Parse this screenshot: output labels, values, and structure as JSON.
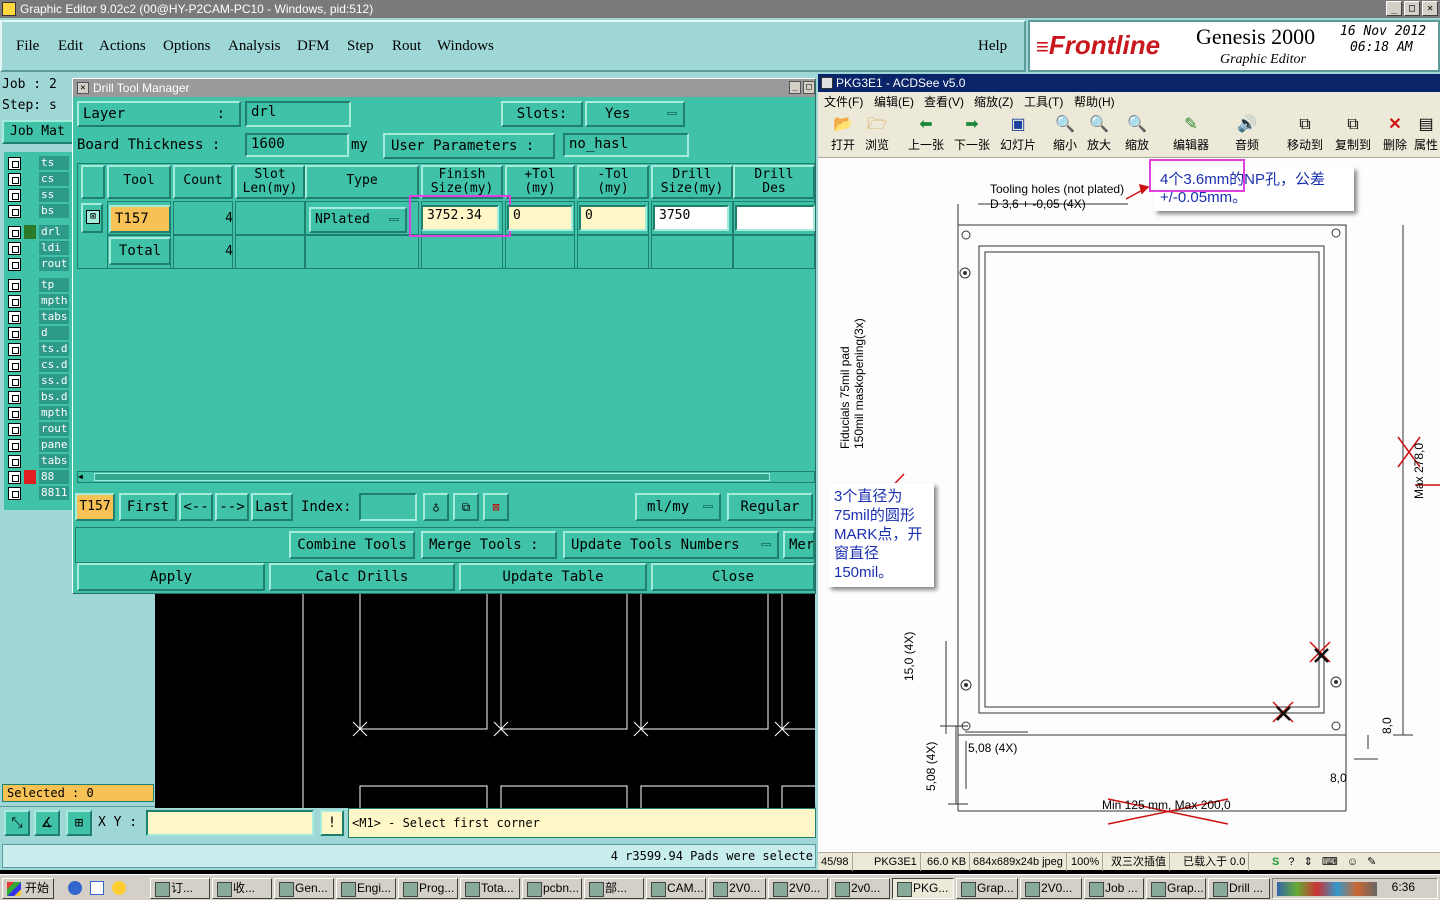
{
  "app": {
    "title": "Graphic Editor 9.02c2 (00@HY-P2CAM-PC10 - Windows, pid:512)",
    "menu": [
      "File",
      "Edit",
      "Actions",
      "Options",
      "Analysis",
      "DFM",
      "Step",
      "Rout",
      "Windows"
    ],
    "help": "Help",
    "brand": "Frontline",
    "product": "Genesis 2000",
    "module": "Graphic Editor",
    "date": "16 Nov 2012",
    "time": "06:18 AM",
    "job_label": "Job : 2",
    "step_label": "Step: s",
    "job_matrix": "Job Mat",
    "selected": "Selected : 0",
    "xy_label": "X Y :",
    "xy_value": "",
    "prompt": "<M1> - Select first corner",
    "status": "4 r3599.94 Pads were selecte"
  },
  "layers": [
    {
      "name": "ts",
      "color": "#2e9a8a"
    },
    {
      "name": "cs",
      "color": "#2e9a8a"
    },
    {
      "name": "ss",
      "color": "#2e9a8a"
    },
    {
      "name": "bs",
      "color": "#2e9a8a"
    },
    {
      "name": "drl",
      "color": "#2e9a8a"
    },
    {
      "name": "ldi",
      "color": "#2e9a8a"
    },
    {
      "name": "rout",
      "color": "#2e9a8a"
    },
    {
      "name": "tp",
      "color": "#2e9a8a"
    },
    {
      "name": "mpth",
      "color": "#2e9a8a"
    },
    {
      "name": "tabs",
      "color": "#2e9a8a"
    },
    {
      "name": "d",
      "color": "#2e9a8a"
    },
    {
      "name": "ts.d",
      "color": "#2e9a8a"
    },
    {
      "name": "cs.d",
      "color": "#2e9a8a"
    },
    {
      "name": "ss.d",
      "color": "#2e9a8a"
    },
    {
      "name": "bs.d",
      "color": "#2e9a8a"
    },
    {
      "name": "mpth",
      "color": "#2e9a8a"
    },
    {
      "name": "rout",
      "color": "#2e9a8a"
    },
    {
      "name": "pane",
      "color": "#2e9a8a"
    },
    {
      "name": "tabs",
      "color": "#2e9a8a"
    },
    {
      "name": "88",
      "color": "#2e9a8a"
    },
    {
      "name": "8811",
      "color": "#2e9a8a"
    }
  ],
  "dtm": {
    "title": "Drill Tool Manager",
    "layer_label": "Layer",
    "layer_colon": ":",
    "layer_value": "drl",
    "slots_label": "Slots:",
    "slots_value": "Yes",
    "board_label": "Board Thickness :",
    "board_value": "1600",
    "board_unit": "my",
    "user_params": "User Parameters :",
    "user_params_value": "no_hasl",
    "headers": [
      "Tool",
      "Count",
      "Slot\nLen(my)",
      "Type",
      "Finish\nSize(my)",
      "+Tol\n(my)",
      "-Tol\n(my)",
      "Drill\nSize(my)",
      "Drill\nDes"
    ],
    "row": {
      "tool": "T157",
      "count": "4",
      "type": "NPlated",
      "finish": "3752.34",
      "ptol": "0",
      "mtol": "0",
      "drill": "3750"
    },
    "total": {
      "label": "Total",
      "count": "4"
    },
    "nav": {
      "current": "T157",
      "first": "First",
      "prev": "<--",
      "next": "-->",
      "last": "Last",
      "index": "Index:",
      "units": "ml/my",
      "mode": "Regular"
    },
    "combine": "Combine Tools",
    "merge": "Merge Tools :",
    "update_numbers": "Update Tools Numbers",
    "mer": "Mer",
    "apply": "Apply",
    "calc": "Calc Drills",
    "update_table": "Update Table",
    "close": "Close"
  },
  "acdsee": {
    "title": "PKG3E1 - ACDSee v5.0",
    "menu": [
      "文件(F)",
      "编辑(E)",
      "查看(V)",
      "缩放(Z)",
      "工具(T)",
      "帮助(H)"
    ],
    "tools": [
      "打开",
      "浏览",
      "上一张",
      "下一张",
      "幻灯片",
      "缩小",
      "放大",
      "缩放",
      "编辑器",
      "音频",
      "移动到",
      "复制到",
      "删除",
      "属性"
    ],
    "status": [
      "45/98",
      "PKG3E1",
      "66.0 KB",
      "684x689x24b jpeg",
      "100%",
      "双三次插值",
      "已载入于 0.0"
    ],
    "drawing": {
      "tooling": "Tooling holes (not plated)",
      "tooling_dim": "D 3,6  +   -0,05 (4X)",
      "fiducial1": "Fiducials 75mil pad",
      "fiducial2": "150mil maskopening(3x)",
      "max": "Max 278,0",
      "d150": "15,0 (4X)",
      "d508a": "5,08 (4X)",
      "d508b": "5,08 (4X)",
      "d80a": "8,0",
      "d80b": "8,0",
      "minmax": "Min 125 mm, Max 200,0"
    },
    "annot1": "4个3.6mm的NP孔，公差+/-0.05mm。",
    "annot2": "3个直径为75mil的圆形MARK点，开窗直径150mil。"
  },
  "taskbar": {
    "start": "开始",
    "items": [
      "订...",
      "收...",
      "Gen...",
      "Engi...",
      "Prog...",
      "Tota...",
      "pcbn...",
      "部...",
      "CAM...",
      "2V0...",
      "2V0...",
      "2v0...",
      "PKG...",
      "Grap...",
      "2V0...",
      "Job ...",
      "Grap...",
      "Drill ..."
    ],
    "clock": "6:36"
  }
}
